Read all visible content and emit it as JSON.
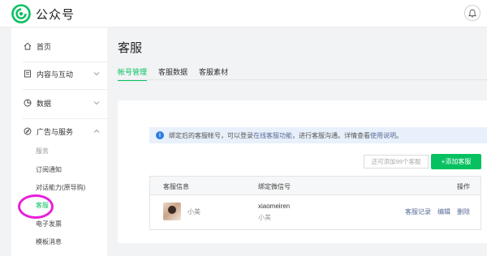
{
  "header": {
    "app_title": "公众号",
    "logo_icon": "wechat-official-account-logo",
    "bell_icon": "bell-icon"
  },
  "sidebar": {
    "items": [
      {
        "label": "首页",
        "icon": "home-icon"
      },
      {
        "label": "内容与互动",
        "icon": "document-icon",
        "expanded": false
      },
      {
        "label": "数据",
        "icon": "pie-chart-icon",
        "expanded": false
      },
      {
        "label": "广告与服务",
        "icon": "compass-icon",
        "expanded": true
      }
    ],
    "sub_items": [
      {
        "label": "服务",
        "state": "muted"
      },
      {
        "label": "订阅通知",
        "state": "normal"
      },
      {
        "label": "对话能力(原导购)",
        "state": "normal"
      },
      {
        "label": "客服",
        "state": "active"
      },
      {
        "label": "电子发票",
        "state": "normal"
      },
      {
        "label": "模板消息",
        "state": "normal"
      }
    ]
  },
  "main": {
    "title": "客服",
    "tabs": [
      {
        "label": "帐号管理",
        "active": true
      },
      {
        "label": "客服数据",
        "active": false
      },
      {
        "label": "客服素材",
        "active": false
      }
    ],
    "notice": {
      "text_before": "绑定后的客服帐号，可以登录",
      "link1": "在线客服功能",
      "text_mid": "，进行客服沟通。详情查看",
      "link2": "使用说明",
      "text_after": "。"
    },
    "quota_placeholder": "还可添加99个客服",
    "add_button": "+添加客服",
    "table": {
      "headers": [
        "客服信息",
        "绑定微信号",
        "操作"
      ],
      "rows": [
        {
          "name": "小美",
          "wechat_id": "xiaomeiren",
          "wechat_nick": "小美",
          "actions": [
            "客服记录",
            "编辑",
            "删除"
          ]
        }
      ]
    }
  },
  "colors": {
    "brand_green": "#07c160",
    "link_blue": "#576b95",
    "notice_bg": "#e8f0fb",
    "highlight_circle": "#e81fd8"
  }
}
